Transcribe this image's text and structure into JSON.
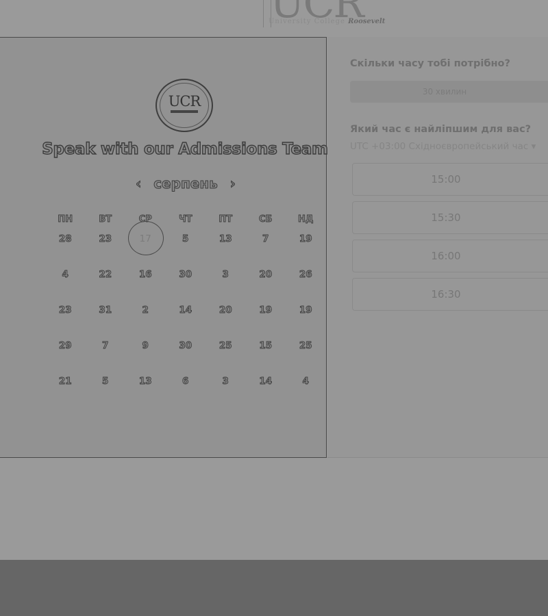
{
  "header": {
    "logo_big": "UCR",
    "logo_line1": "University College",
    "logo_line2": "Roosevelt"
  },
  "calendar": {
    "emblem_text": "UCR",
    "title": "Speak with our Admissions Team",
    "prev_icon": "chevron-left-icon",
    "next_icon": "chevron-right-icon",
    "prev_glyph": "‹",
    "next_glyph": "›",
    "month": "серпень",
    "weekdays": [
      "ПН",
      "ВТ",
      "СР",
      "ЧТ",
      "ПТ",
      "СБ",
      "НД"
    ],
    "weeks": [
      [
        "28",
        "23",
        "17",
        "5",
        "13",
        "7",
        "19"
      ],
      [
        "4",
        "22",
        "16",
        "30",
        "3",
        "20",
        "26"
      ],
      [
        "23",
        "31",
        "2",
        "14",
        "20",
        "19",
        "19"
      ],
      [
        "29",
        "7",
        "9",
        "30",
        "25",
        "15",
        "25"
      ],
      [
        "21",
        "5",
        "13",
        "6",
        "3",
        "14",
        "4"
      ]
    ],
    "selected_day": "17"
  },
  "booking": {
    "duration_question": "Скільки часу тобі потрібно?",
    "duration_value": "30 хвилин",
    "time_question": "Який час є найліпшим для вас?",
    "timezone": "UTC +03:00 Східноєвропейський час",
    "timezone_caret": "▾",
    "slots": [
      "15:00",
      "15:30",
      "16:00",
      "16:30"
    ]
  },
  "colors": {
    "overlay_background": "#9a9a9a",
    "footer": "#666666"
  }
}
